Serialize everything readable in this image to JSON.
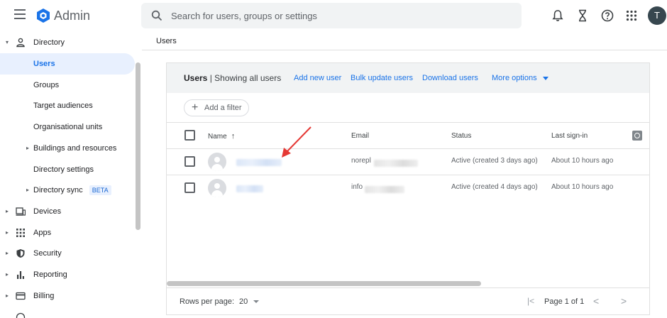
{
  "header": {
    "app_title": "Admin",
    "search_placeholder": "Search for users, groups or settings",
    "avatar_initial": "T",
    "icons": [
      "menu-icon",
      "admin-logo",
      "search-icon",
      "notifications-bell-icon",
      "hourglass-icon",
      "help-icon",
      "apps-grid-icon"
    ]
  },
  "sidebar": {
    "items": [
      {
        "label": "Directory",
        "caret": "▾",
        "icon": "person-icon"
      },
      {
        "label": "Users",
        "active": true
      },
      {
        "label": "Groups"
      },
      {
        "label": "Target audiences"
      },
      {
        "label": "Organisational units"
      },
      {
        "label": "Buildings and resources",
        "caret": "▸"
      },
      {
        "label": "Directory settings"
      },
      {
        "label": "Directory sync",
        "caret": "▸",
        "badge": "BETA"
      },
      {
        "label": "Devices",
        "caret": "▸",
        "icon": "devices-icon"
      },
      {
        "label": "Apps",
        "caret": "▸",
        "icon": "apps-icon"
      },
      {
        "label": "Security",
        "caret": "▸",
        "icon": "shield-icon"
      },
      {
        "label": "Reporting",
        "caret": "▸",
        "icon": "bar-chart-icon"
      },
      {
        "label": "Billing",
        "caret": "▸",
        "icon": "credit-card-icon"
      }
    ]
  },
  "breadcrumb": "Users",
  "card": {
    "title_bold": "Users",
    "title_rest": "| Showing all users",
    "actions": [
      "Add new user",
      "Bulk update users",
      "Download users",
      "More options"
    ],
    "filter_label": "Add a filter",
    "columns": {
      "name": "Name",
      "name_sort": "↑",
      "email": "Email",
      "status": "Status",
      "last_signin": "Last sign-in"
    },
    "rows": [
      {
        "email_prefix": "norepl",
        "status": "Active (created 3 days ago)",
        "last_signin": "About 10 hours ago"
      },
      {
        "email_prefix": "info",
        "status": "Active (created 4 days ago)",
        "last_signin": "About 10 hours ago"
      }
    ],
    "footer": {
      "rows_per_page_label": "Rows per page:",
      "rows_per_page_value": "20",
      "page_label": "Page 1 of 1",
      "first_page": "|<",
      "prev": "<",
      "next": ">"
    }
  },
  "colors": {
    "accent": "#1a73e8",
    "header_bg": "#f1f3f4",
    "annotation_arrow": "#e53935"
  }
}
